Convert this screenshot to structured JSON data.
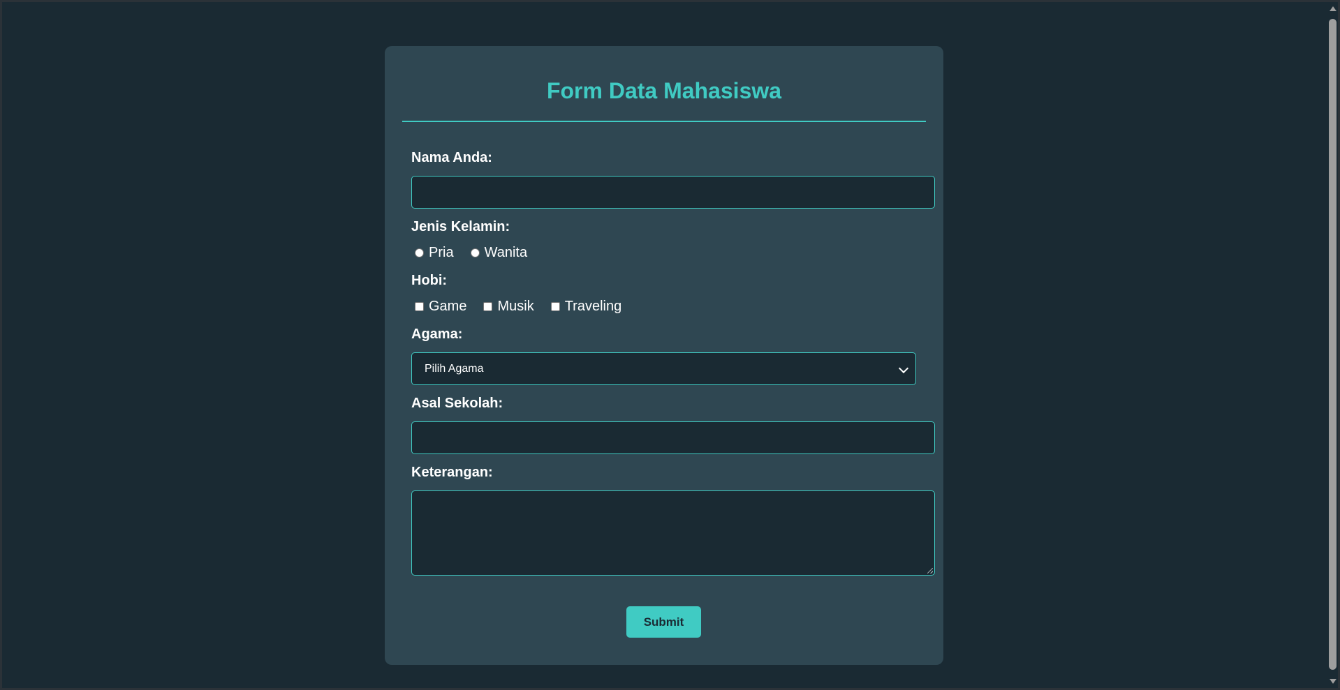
{
  "form": {
    "title": "Form Data Mahasiswa",
    "nama": {
      "label": "Nama Anda:",
      "value": ""
    },
    "jenis_kelamin": {
      "label": "Jenis Kelamin:",
      "options": [
        "Pria",
        "Wanita"
      ]
    },
    "hobi": {
      "label": "Hobi:",
      "options": [
        "Game",
        "Musik",
        "Traveling"
      ]
    },
    "agama": {
      "label": "Agama:",
      "selected": "Pilih Agama"
    },
    "asal_sekolah": {
      "label": "Asal Sekolah:",
      "value": ""
    },
    "keterangan": {
      "label": "Keterangan:",
      "value": ""
    },
    "submit_label": "Submit"
  },
  "colors": {
    "page_bg": "#1a2a33",
    "card_bg": "#2f4752",
    "accent": "#40cbc3",
    "text": "#ffffff"
  }
}
